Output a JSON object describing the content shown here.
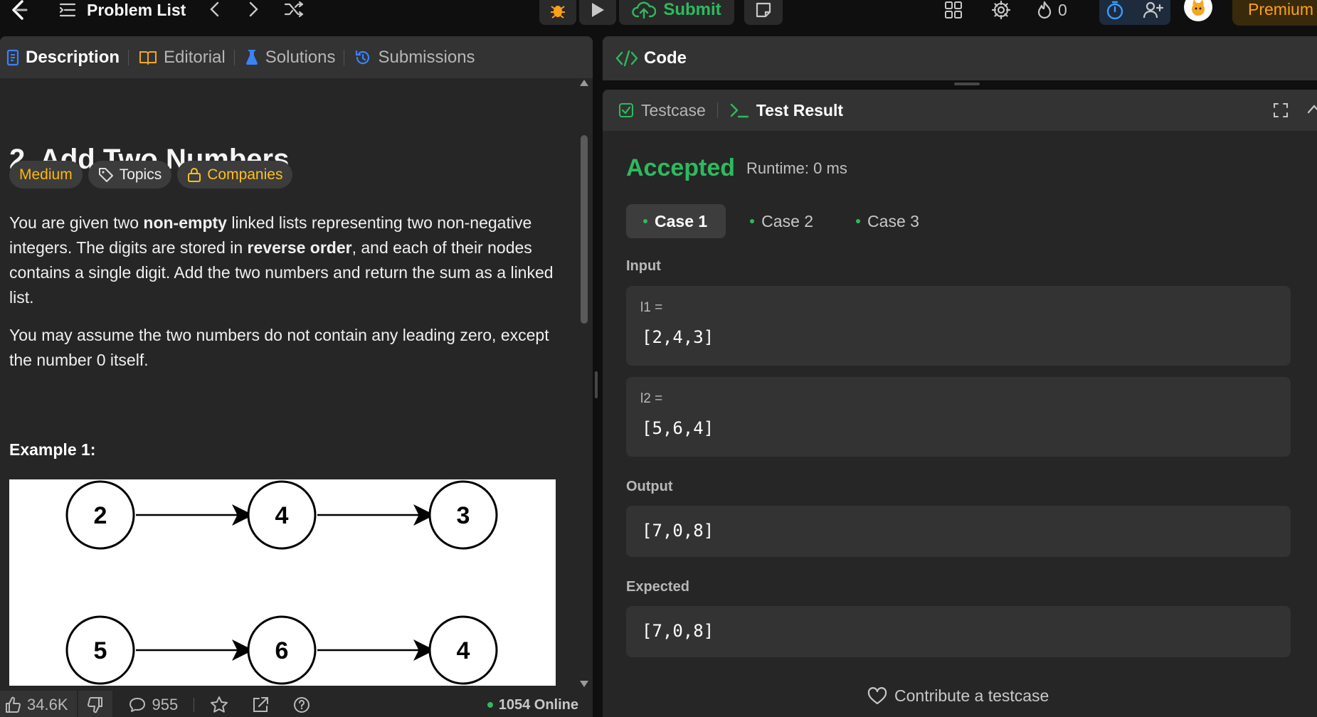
{
  "topbar": {
    "problem_list_label": "Problem List",
    "submit_label": "Submit",
    "streak_count": "0",
    "premium_label": "Premium"
  },
  "left": {
    "tabs": [
      {
        "label": "Description"
      },
      {
        "label": "Editorial"
      },
      {
        "label": "Solutions"
      },
      {
        "label": "Submissions"
      }
    ],
    "title": "2. Add Two Numbers",
    "chips": {
      "difficulty": "Medium",
      "topics": "Topics",
      "companies": "Companies"
    },
    "desc": {
      "p1_a": "You are given two ",
      "p1_b": "non-empty",
      "p1_c": " linked lists representing two non-negative integers. The digits are stored in ",
      "p1_d": "reverse order",
      "p1_e": ", and each of their nodes contains a single digit. Add the two numbers and return the sum as a linked list.",
      "p2": "You may assume the two numbers do not contain any leading zero, except the number 0 itself."
    },
    "example_title": "Example 1:",
    "diagram": {
      "row1": [
        "2",
        "4",
        "3"
      ],
      "row2": [
        "5",
        "6",
        "4"
      ]
    },
    "bottom": {
      "likes": "34.6K",
      "comments": "955",
      "online": "1054 Online"
    }
  },
  "right": {
    "code_title": "Code",
    "tabs": {
      "testcase": "Testcase",
      "test_result": "Test Result"
    },
    "status": "Accepted",
    "runtime": "Runtime: 0 ms",
    "cases": [
      "Case 1",
      "Case 2",
      "Case 3"
    ],
    "input_label": "Input",
    "inputs": [
      {
        "name": "l1 =",
        "value": "[2,4,3]"
      },
      {
        "name": "l2 =",
        "value": "[5,6,4]"
      }
    ],
    "output_label": "Output",
    "output_value": "[7,0,8]",
    "expected_label": "Expected",
    "expected_value": "[7,0,8]",
    "contribute_label": "Contribute a testcase"
  },
  "colors": {
    "accent_green": "#2cbb5d",
    "premium_orange": "#ffa116",
    "medium_yellow": "#ffb800"
  }
}
